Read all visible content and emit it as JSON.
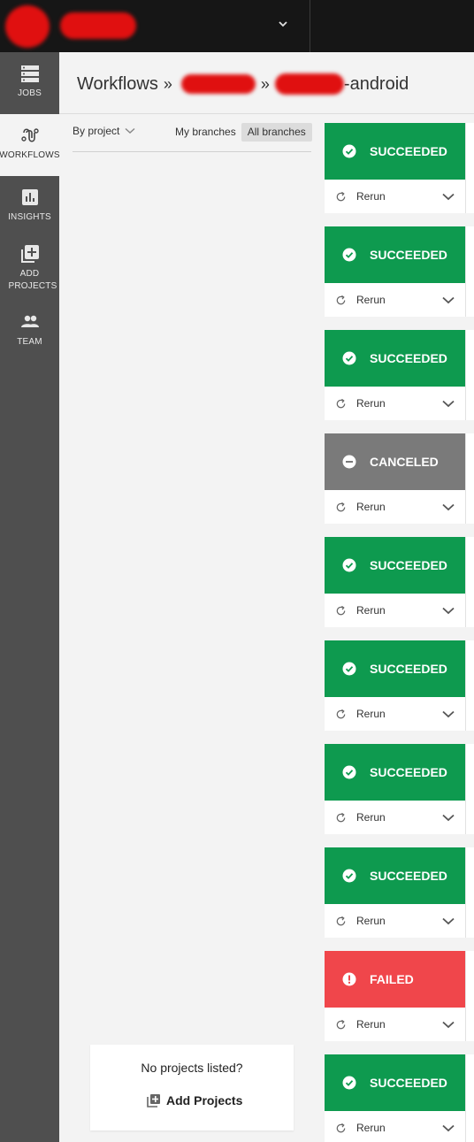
{
  "org": {
    "avatar_initial": "",
    "name": ""
  },
  "sidebar": {
    "items": [
      {
        "key": "jobs",
        "label": "JOBS",
        "icon": "jobs-icon"
      },
      {
        "key": "workflows",
        "label": "WORKFLOWS",
        "icon": "workflows-icon",
        "active": true
      },
      {
        "key": "insights",
        "label": "INSIGHTS",
        "icon": "insights-icon"
      },
      {
        "key": "add-projects",
        "label": "ADD PROJECTS",
        "icon": "add-projects-icon"
      },
      {
        "key": "team",
        "label": "TEAM",
        "icon": "team-icon"
      }
    ]
  },
  "header": {
    "title": "Workflows",
    "separator": "»",
    "project_suffix": "-android"
  },
  "filters": {
    "by_project_label": "By project",
    "my_branches_label": "My branches",
    "all_branches_label": "All branches",
    "selected": "All branches"
  },
  "empty_state": {
    "message": "No projects listed?",
    "add_projects_label": "Add Projects"
  },
  "workflows": [
    {
      "status": "SUCCEEDED",
      "state": "succeeded",
      "action": "Rerun"
    },
    {
      "status": "SUCCEEDED",
      "state": "succeeded",
      "action": "Rerun"
    },
    {
      "status": "SUCCEEDED",
      "state": "succeeded",
      "action": "Rerun"
    },
    {
      "status": "CANCELED",
      "state": "canceled",
      "action": "Rerun"
    },
    {
      "status": "SUCCEEDED",
      "state": "succeeded",
      "action": "Rerun"
    },
    {
      "status": "SUCCEEDED",
      "state": "succeeded",
      "action": "Rerun"
    },
    {
      "status": "SUCCEEDED",
      "state": "succeeded",
      "action": "Rerun"
    },
    {
      "status": "SUCCEEDED",
      "state": "succeeded",
      "action": "Rerun"
    },
    {
      "status": "FAILED",
      "state": "failed",
      "action": "Rerun"
    },
    {
      "status": "SUCCEEDED",
      "state": "succeeded",
      "action": "Rerun"
    }
  ],
  "colors": {
    "succeeded": "#0e9a4f",
    "canceled": "#7a7a7a",
    "failed": "#f0464b",
    "topbar": "#161616",
    "sidebar": "#4f4f4f"
  }
}
